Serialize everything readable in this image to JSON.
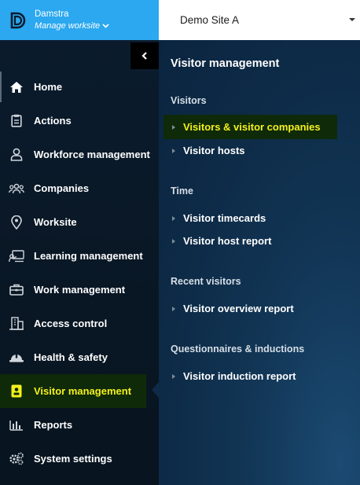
{
  "brand": {
    "name": "Damstra",
    "subtitle": "Manage worksite",
    "logo_icon": "damstra-logo-icon",
    "accent_color": "#2ba8ef"
  },
  "site_select": {
    "value": "Demo Site A"
  },
  "sidebar": {
    "items": [
      {
        "label": "Home",
        "icon": "home-icon"
      },
      {
        "label": "Actions",
        "icon": "clipboard-icon"
      },
      {
        "label": "Workforce management",
        "icon": "user-icon"
      },
      {
        "label": "Companies",
        "icon": "group-icon"
      },
      {
        "label": "Worksite",
        "icon": "map-pin-icon"
      },
      {
        "label": "Learning management",
        "icon": "learning-icon"
      },
      {
        "label": "Work management",
        "icon": "briefcase-icon"
      },
      {
        "label": "Access control",
        "icon": "building-icon"
      },
      {
        "label": "Health & safety",
        "icon": "hard-hat-icon"
      },
      {
        "label": "Visitor management",
        "icon": "visitor-badge-icon"
      },
      {
        "label": "Reports",
        "icon": "bar-chart-icon"
      },
      {
        "label": "System settings",
        "icon": "gears-icon"
      }
    ],
    "active_item": "Visitor management",
    "active_color": "#f3f01c"
  },
  "panel": {
    "title": "Visitor management",
    "sections": [
      {
        "title": "Visitors",
        "items": [
          "Visitors & visitor companies",
          "Visitor hosts"
        ]
      },
      {
        "title": "Time",
        "items": [
          "Visitor timecards",
          "Visitor host report"
        ]
      },
      {
        "title": "Recent visitors",
        "items": [
          "Visitor overview report"
        ]
      },
      {
        "title": "Questionnaires & inductions",
        "items": [
          "Visitor induction report"
        ]
      }
    ],
    "active_item": "Visitors & visitor companies"
  }
}
